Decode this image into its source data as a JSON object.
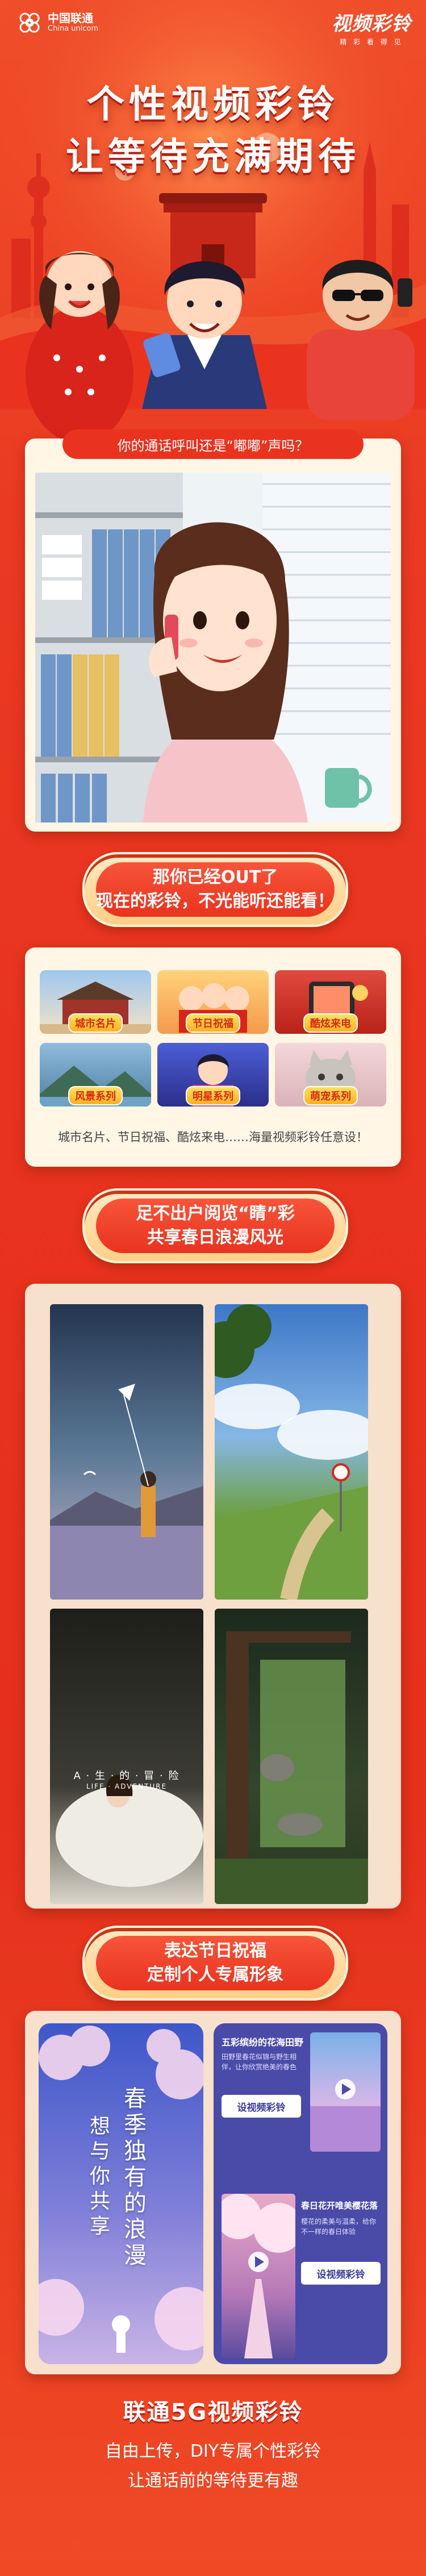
{
  "header": {
    "carrier_cn": "中国联通",
    "carrier_en": "China unicom",
    "brand_cn": "视频彩铃",
    "brand_sub": "精 彩 看 得 见"
  },
  "hero": {
    "title_line1": "个性视频彩铃",
    "title_line2": "让等待充满期待"
  },
  "section1": {
    "question": "你的通话呼叫还是“嘟嘟”声吗？"
  },
  "banner1": {
    "line1": "那你已经OUT了",
    "line2": "现在的彩铃，不光能听还能看！"
  },
  "categories": {
    "items": [
      {
        "label": "城市名片"
      },
      {
        "label": "节日祝福"
      },
      {
        "label": "酷炫来电"
      },
      {
        "label": "风景系列"
      },
      {
        "label": "明星系列"
      },
      {
        "label": "萌宠系列"
      }
    ],
    "description": "城市名片、节日祝福、酷炫来电……海量视频彩铃任意设！"
  },
  "banner2": {
    "line1": "足不出户阅览“睛”彩",
    "line2": "共享春日浪漫风光"
  },
  "gallery": {
    "overlay_text": "A · 生 · 的 · 冒 · 险",
    "overlay_sub": "LIFE · ADVENTURE"
  },
  "banner3": {
    "line1": "表达节日祝福",
    "line2": "定制个人专属形象"
  },
  "custom": {
    "poem_line1": "春季独有的浪漫",
    "poem_line2": "想与你共享",
    "card1_title": "五彩缤纷的花海田野",
    "card1_text": "田野里春花似锦与野生相伴，让你欣赏绝美的春色",
    "card1_button": "设视频彩铃",
    "card2_title": "春日花开唯美樱花落",
    "card2_text": "樱花的柔美与温柔，给你不一样的春日体验",
    "card2_button": "设视频彩铃"
  },
  "footer": {
    "title": "联通5G视频彩铃",
    "line1": "自由上传，DIY专属个性彩铃",
    "line2": "让通话前的等待更有趣"
  },
  "colors": {
    "primary_red": "#e8331e",
    "gold": "#ffcf86",
    "cream": "#fff6e6"
  }
}
